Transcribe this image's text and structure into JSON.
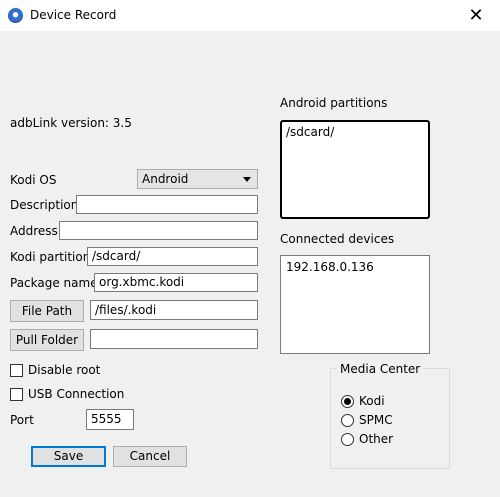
{
  "window": {
    "title": "Device Record",
    "icon": "kodi-app-icon",
    "close_glyph": "✕"
  },
  "adblink_version": "adbLink version: 3.5",
  "form": {
    "kodi_os": {
      "label": "Kodi OS",
      "value": "Android"
    },
    "description": {
      "label": "Description",
      "value": ""
    },
    "address": {
      "label": "Address",
      "value": ""
    },
    "kodi_partition": {
      "label": "Kodi partition",
      "value": "/sdcard/"
    },
    "package_name": {
      "label": "Package name",
      "value": "org.xbmc.kodi"
    },
    "file_path": {
      "button_label": "File Path",
      "value": "/files/.kodi"
    },
    "pull_folder": {
      "button_label": "Pull Folder",
      "value": ""
    },
    "disable_root": {
      "label": "Disable root",
      "checked": false
    },
    "usb_connection": {
      "label": "USB Connection",
      "checked": false
    },
    "port": {
      "label": "Port",
      "value": "5555"
    }
  },
  "buttons": {
    "save": "Save",
    "cancel": "Cancel"
  },
  "android_partitions": {
    "label": "Android partitions",
    "items": [
      "/sdcard/"
    ]
  },
  "connected_devices": {
    "label": "Connected devices",
    "items": [
      "192.168.0.136"
    ]
  },
  "media_center": {
    "label": "Media Center",
    "options": [
      {
        "label": "Kodi",
        "selected": true
      },
      {
        "label": "SPMC",
        "selected": false
      },
      {
        "label": "Other",
        "selected": false
      }
    ]
  }
}
